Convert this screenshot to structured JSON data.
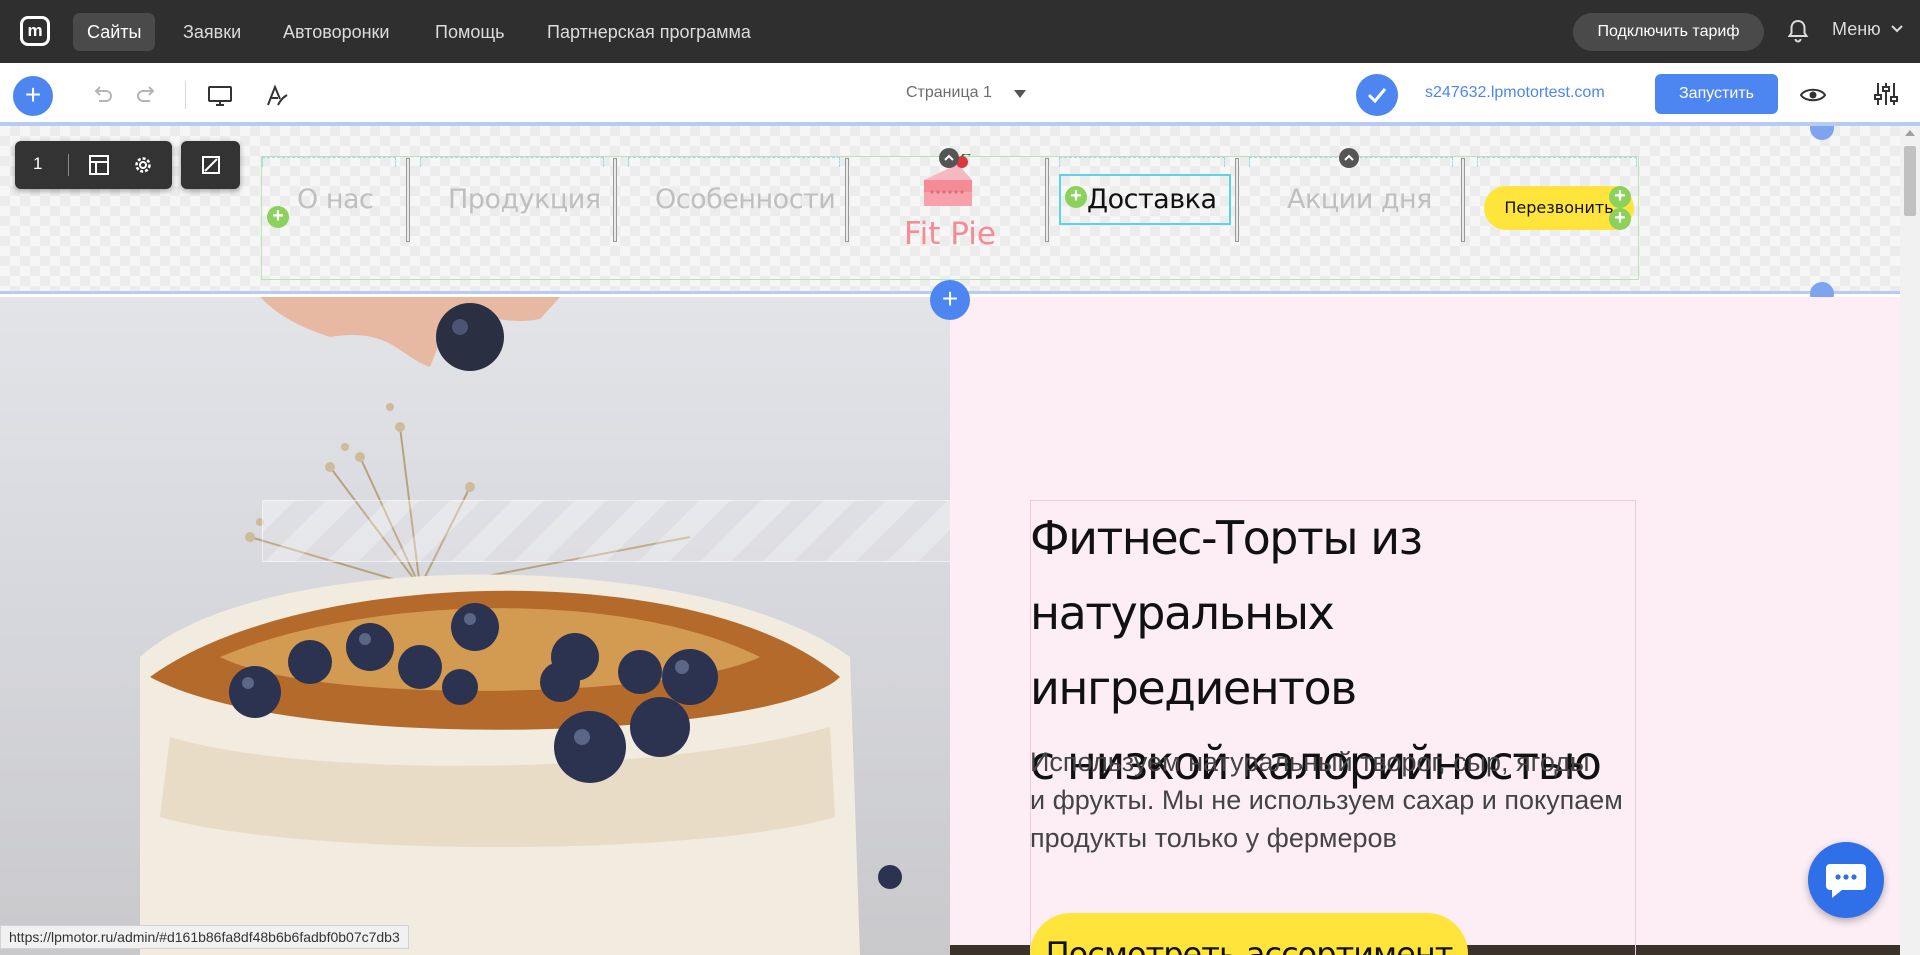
{
  "topnav": {
    "items": [
      {
        "label": "Сайты",
        "active": true
      },
      {
        "label": "Заявки"
      },
      {
        "label": "Автоворонки"
      },
      {
        "label": "Помощь"
      },
      {
        "label": "Партнерская программа"
      }
    ],
    "tariff_button": "Подключить тариф",
    "menu_label": "Меню"
  },
  "toolbar": {
    "page_select": "Страница 1",
    "domain": "s247632.lpmotortest.com",
    "launch_button": "Запустить"
  },
  "block_controls": {
    "number": "1"
  },
  "site_header": {
    "menu": [
      {
        "label": "О нас"
      },
      {
        "label": "Продукция"
      },
      {
        "label": "Особенности"
      },
      {
        "label": "Доставка",
        "selected": true
      },
      {
        "label": "Акции дня"
      }
    ],
    "brand": "Fit Pie",
    "call_button": "Перезвонить"
  },
  "hero": {
    "title_line1": "Фитнес-Торты из натуральных",
    "title_line2": "ингредиентов",
    "title_line3": "с низкой калорийностью",
    "subtitle_line1": "Используем натуральный творог, сыр, ягоды",
    "subtitle_line2": "и фрукты. Мы не используем сахар и покупаем",
    "subtitle_line3": "продукты только у фермеров",
    "cta": "Посмотреть ассортимент"
  },
  "status_bar": {
    "url": "https://lpmotor.ru/admin/#d161b86fa8df48b6b6fadbf0b07c7db3"
  },
  "colors": {
    "accent": "#4d86f0",
    "cta_yellow": "#ffe53b",
    "hero_bg": "#fdeef6",
    "brand_pink": "#f48b97",
    "topbar": "#2f2f2f"
  }
}
